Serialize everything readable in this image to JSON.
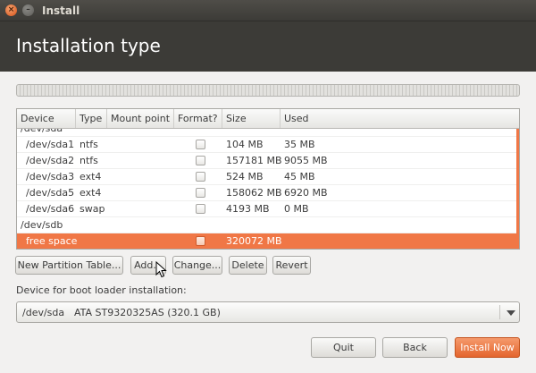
{
  "window": {
    "title": "Install"
  },
  "header": {
    "title": "Installation type"
  },
  "table": {
    "columns": [
      "Device",
      "Type",
      "Mount point",
      "Format?",
      "Size",
      "Used"
    ],
    "rows": [
      {
        "device": "/dev/sda",
        "type": "",
        "mount": "",
        "format": "",
        "size": "",
        "used": "",
        "partial": true
      },
      {
        "device": "/dev/sda1",
        "type": "ntfs",
        "mount": "",
        "format": "checkbox",
        "size": "104 MB",
        "used": "35 MB"
      },
      {
        "device": "/dev/sda2",
        "type": "ntfs",
        "mount": "",
        "format": "checkbox",
        "size": "157181 MB",
        "used": "9055 MB"
      },
      {
        "device": "/dev/sda3",
        "type": "ext4",
        "mount": "",
        "format": "checkbox",
        "size": "524 MB",
        "used": "45 MB"
      },
      {
        "device": "/dev/sda5",
        "type": "ext4",
        "mount": "",
        "format": "checkbox",
        "size": "158062 MB",
        "used": "6920 MB"
      },
      {
        "device": "/dev/sda6",
        "type": "swap",
        "mount": "",
        "format": "checkbox",
        "size": "4193 MB",
        "used": "0 MB"
      },
      {
        "device": "/dev/sdb",
        "type": "",
        "mount": "",
        "format": "",
        "size": "",
        "used": ""
      },
      {
        "device": "free space",
        "type": "",
        "mount": "",
        "format": "checkbox",
        "size": "320072 MB",
        "used": "",
        "selected": true
      }
    ]
  },
  "actions": {
    "new_table": "New Partition Table...",
    "add": "Add...",
    "change": "Change...",
    "delete": "Delete",
    "revert": "Revert"
  },
  "bootloader": {
    "label": "Device for boot loader installation:",
    "device": "/dev/sda",
    "disk": "ATA ST9320325AS (320.1 GB)"
  },
  "footer": {
    "quit": "Quit",
    "back": "Back",
    "install": "Install Now"
  },
  "colors": {
    "accent": "#f07746",
    "header_bg": "#3c3b37",
    "window_bg": "#f2f1f0"
  },
  "icons": {
    "close": "close-icon",
    "minimize": "minimize-icon",
    "dropdown": "chevron-down-icon",
    "pointer": "mouse-pointer-icon"
  }
}
